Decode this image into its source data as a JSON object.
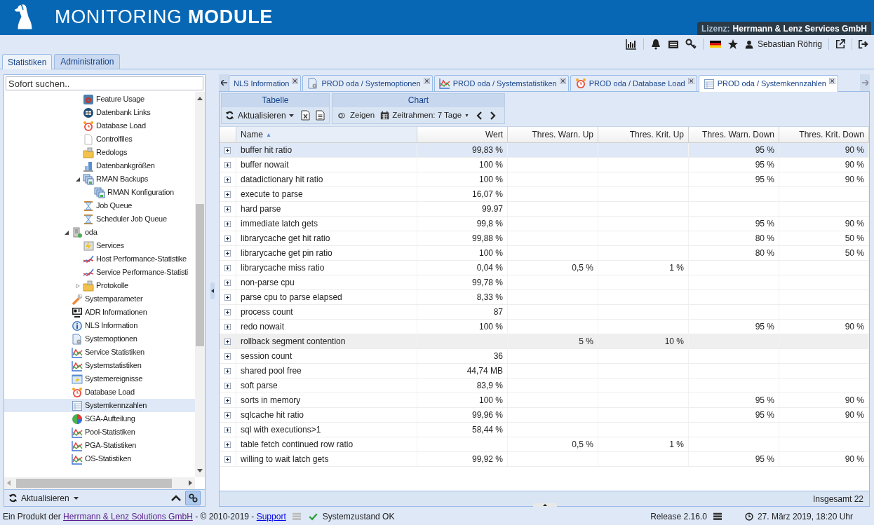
{
  "header": {
    "title": "MONITORING **MODULE**",
    "license_label": "Lizenz:",
    "license_holder": "Herrmann & Lenz Services GmbH"
  },
  "user": {
    "name": "Sebastian Röhrig"
  },
  "main_tabs": [
    {
      "label": "Statistiken",
      "selected": true
    },
    {
      "label": "Administration",
      "selected": false
    }
  ],
  "sidebar": {
    "search": {
      "placeholder": "Sofort suchen.."
    },
    "tree": [
      {
        "children": [
          {
            "label": "Feature Usage",
            "kind": "feature",
            "selected": false
          },
          {
            "label": "Datenbank Links",
            "kind": "links",
            "selected": false
          },
          {
            "label": "Database Load",
            "kind": "alarm",
            "selected": false
          },
          {
            "label": "Controlfiles",
            "kind": "page",
            "selected": false
          },
          {
            "label": "Redologs",
            "kind": "folder",
            "selected": false
          },
          {
            "label": "Datenbankgrößen",
            "kind": "bars",
            "selected": false
          },
          {
            "label": "RMAN Backups",
            "kind": "backup",
            "selected": false,
            "expanded": true,
            "children": [
              {
                "label": "RMAN Konfiguration",
                "kind": "backup",
                "selected": false
              }
            ]
          },
          {
            "label": "Job Queue",
            "kind": "hourglass",
            "selected": false
          },
          {
            "label": "Scheduler Job Queue",
            "kind": "hourglass",
            "selected": false
          }
        ]
      },
      {
        "label": "oda",
        "kind": "server",
        "selected": false,
        "expanded": true,
        "children": [
          {
            "label": "Services",
            "kind": "services",
            "selected": false
          },
          {
            "label": "Host Performance-Statistike",
            "kind": "perf",
            "selected": false
          },
          {
            "label": "Service Performance-Statisti",
            "kind": "perf",
            "selected": false
          },
          {
            "label": "Protokolle",
            "kind": "folder",
            "selected": false,
            "expanded": false
          }
        ]
      },
      {
        "label": "Systemparameter",
        "kind": "wrench",
        "selected": false
      },
      {
        "label": "ADR Informationen",
        "kind": "monitor",
        "selected": false
      },
      {
        "label": "NLS Information",
        "kind": "info",
        "selected": false
      },
      {
        "label": "Systemoptionen",
        "kind": "docgear",
        "selected": false
      },
      {
        "label": "Service Statistiken",
        "kind": "stats",
        "selected": false
      },
      {
        "label": "Systemstatistiken",
        "kind": "stats",
        "selected": false
      },
      {
        "label": "Systemereignisse",
        "kind": "events",
        "selected": false
      },
      {
        "label": "Database Load",
        "kind": "alarm",
        "selected": false
      },
      {
        "label": "Systemkennzahlen",
        "kind": "table",
        "selected": true
      },
      {
        "label": "SGA-Aufteilung",
        "kind": "pie",
        "selected": false
      },
      {
        "label": "Pool-Statistiken",
        "kind": "stats",
        "selected": false
      },
      {
        "label": "PGA-Statistiken",
        "kind": "stats",
        "selected": false
      },
      {
        "label": "OS-Statistiken",
        "kind": "stats",
        "selected": false
      }
    ],
    "refresh": "Aktualisieren"
  },
  "content_tabs": [
    {
      "label": "NLS Information",
      "selected": false
    },
    {
      "label": "PROD oda / Systemoptionen",
      "kind": "docgear",
      "selected": false
    },
    {
      "label": "PROD oda / Systemstatistiken",
      "kind": "stats",
      "selected": false
    },
    {
      "label": "PROD oda / Database Load",
      "kind": "alarm",
      "selected": false
    },
    {
      "label": "PROD oda / Systemkennzahlen",
      "kind": "table",
      "selected": true
    }
  ],
  "toolbar": {
    "table_group": "Tabelle",
    "refresh": "Aktualisieren",
    "chart_group": "Chart",
    "show": {
      "label": "Zeigen",
      "on": false
    },
    "timeframe": "Zeitrahmen: 7 Tage"
  },
  "table": {
    "columns": [
      {
        "label": "Name",
        "sorted": true
      },
      {
        "label": "Wert",
        "sorted": false
      },
      {
        "label": "Thres. Warn. Up",
        "sorted": false
      },
      {
        "label": "Thres. Krit. Up",
        "sorted": false
      },
      {
        "label": "Thres. Warn. Down",
        "sorted": false
      },
      {
        "label": "Thres. Krit. Down",
        "sorted": false
      }
    ],
    "rows": [
      {
        "name": "buffer hit ratio",
        "wert": "99,83 %",
        "warn_down": "95 %",
        "krit_down": "90 %",
        "selected": true,
        "hovered": false
      },
      {
        "name": "buffer nowait",
        "wert": "100 %",
        "warn_down": "95 %",
        "krit_down": "90 %",
        "selected": false,
        "hovered": false
      },
      {
        "name": "datadictionary hit ratio",
        "wert": "100 %",
        "warn_down": "95 %",
        "krit_down": "90 %",
        "selected": false,
        "hovered": false
      },
      {
        "name": "execute to parse",
        "wert": "16,07 %",
        "selected": false,
        "hovered": false
      },
      {
        "name": "hard parse",
        "wert": "99.97",
        "selected": false,
        "hovered": false
      },
      {
        "name": "immediate latch gets",
        "wert": "99,8 %",
        "warn_down": "95 %",
        "krit_down": "90 %",
        "selected": false,
        "hovered": false
      },
      {
        "name": "librarycache get hit ratio",
        "wert": "99,88 %",
        "warn_down": "80 %",
        "krit_down": "50 %",
        "selected": false,
        "hovered": false
      },
      {
        "name": "librarycache get pin ratio",
        "wert": "100 %",
        "warn_down": "80 %",
        "krit_down": "50 %",
        "selected": false,
        "hovered": false
      },
      {
        "name": "librarycache miss ratio",
        "wert": "0,04 %",
        "warn_up": "0,5 %",
        "krit_up": "1 %",
        "selected": false,
        "hovered": false
      },
      {
        "name": "non-parse cpu",
        "wert": "99,78 %",
        "selected": false,
        "hovered": false
      },
      {
        "name": "parse cpu to parse elapsed",
        "wert": "8,33 %",
        "selected": false,
        "hovered": false
      },
      {
        "name": "process count",
        "wert": "87",
        "selected": false,
        "hovered": false
      },
      {
        "name": "redo nowait",
        "wert": "100 %",
        "warn_down": "95 %",
        "krit_down": "90 %",
        "selected": false,
        "hovered": false
      },
      {
        "name": "rollback segment contention",
        "warn_up": "5 %",
        "krit_up": "10 %",
        "selected": false,
        "hovered": true
      },
      {
        "name": "session count",
        "wert": "36",
        "selected": false,
        "hovered": false
      },
      {
        "name": "shared pool free",
        "wert": "44,74 MB",
        "selected": false,
        "hovered": false
      },
      {
        "name": "soft parse",
        "wert": "83,9 %",
        "selected": false,
        "hovered": false
      },
      {
        "name": "sorts in memory",
        "wert": "100 %",
        "warn_down": "95 %",
        "krit_down": "90 %",
        "selected": false,
        "hovered": false
      },
      {
        "name": "sqlcache hit ratio",
        "wert": "99,96 %",
        "warn_down": "95 %",
        "krit_down": "90 %",
        "selected": false,
        "hovered": false
      },
      {
        "name": "sql with executions>1",
        "wert": "58,44 %",
        "selected": false,
        "hovered": false
      },
      {
        "name": "table fetch continued row ratio",
        "warn_up": "0,5 %",
        "krit_up": "1 %",
        "selected": false,
        "hovered": false
      },
      {
        "name": "willing to wait latch gets",
        "wert": "99,92 %",
        "warn_down": "95 %",
        "krit_down": "90 %",
        "selected": false,
        "hovered": false
      }
    ],
    "total": "Insgesamt 22"
  },
  "status_bar": {
    "credit": "Ein Produkt der ",
    "company_link": "Herrmann & Lenz Solutions GmbH",
    "copyright": " - © 2010-2019 - ",
    "support_link": "Support",
    "health": "Systemzustand OK",
    "release": "Release 2.16.0",
    "datetime": "27. März 2019, 18:20 Uhr"
  }
}
